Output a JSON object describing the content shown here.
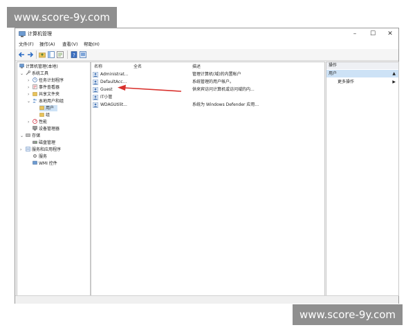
{
  "watermark": {
    "top": "www.score-9y.com",
    "bottom": "www.score-9y.com"
  },
  "window": {
    "title": "计算机管理",
    "minimize": "–",
    "maximize": "☐",
    "close": "✕"
  },
  "menu": [
    "文件(F)",
    "操作(A)",
    "查看(V)",
    "帮助(H)"
  ],
  "tree": {
    "root": "计算机管理(本地)",
    "system_tools": "系统工具",
    "task_scheduler": "任务计划程序",
    "event_viewer": "事件查看器",
    "shared_folders": "共享文件夹",
    "local_users_groups": "本地用户和组",
    "users": "用户",
    "groups": "组",
    "performance": "性能",
    "device_manager": "设备管理器",
    "storage": "存储",
    "disk_management": "磁盘管理",
    "services_apps": "服务和应用程序",
    "services": "服务",
    "wmi": "WMI 控件"
  },
  "list": {
    "headers": {
      "name": "名称",
      "fullname": "全名",
      "description": "描述"
    },
    "rows": [
      {
        "name": "Administrat...",
        "fullname": "",
        "description": "管理计算机(域)的内置帐户"
      },
      {
        "name": "DefaultAcc...",
        "fullname": "",
        "description": "系统管理的用户帐户。"
      },
      {
        "name": "Guest",
        "fullname": "",
        "description": "供来宾访问计算机或访问域的内..."
      },
      {
        "name": "IT小管",
        "fullname": "",
        "description": ""
      },
      {
        "name": "WDAGUtilit...",
        "fullname": "",
        "description": "系统为 Windows Defender 应用..."
      }
    ]
  },
  "actions": {
    "header": "操作",
    "section": "用户",
    "more": "更多操作"
  },
  "colors": {
    "selection": "#cde2f6",
    "arrow": "#d9302c"
  },
  "icons": [
    "back-icon",
    "forward-icon",
    "folder-icon",
    "properties-icon",
    "help-icon",
    "console-icon",
    "user-icon"
  ]
}
